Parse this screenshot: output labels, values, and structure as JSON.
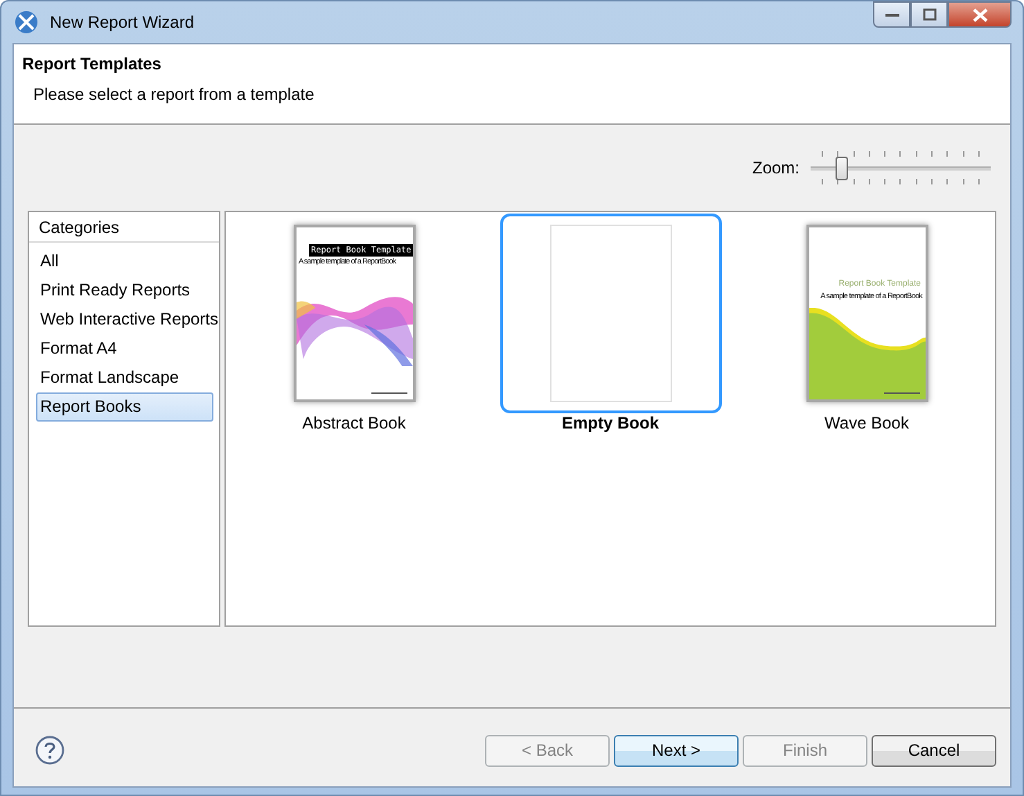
{
  "window": {
    "title": "New Report Wizard"
  },
  "header": {
    "title": "Report Templates",
    "description": "Please select a report from a template"
  },
  "zoom": {
    "label": "Zoom:",
    "level": 0.1
  },
  "categories": {
    "heading": "Categories",
    "items": [
      {
        "label": "All",
        "selected": false
      },
      {
        "label": "Print Ready Reports",
        "selected": false
      },
      {
        "label": "Web Interactive Reports",
        "selected": false
      },
      {
        "label": "Format A4",
        "selected": false
      },
      {
        "label": "Format Landscape",
        "selected": false
      },
      {
        "label": "Report Books",
        "selected": true
      }
    ]
  },
  "templates": [
    {
      "name": "Abstract Book",
      "kind": "abstract",
      "cover_title": "Report Book Template",
      "cover_subtitle": "A sample template of a ReportBook",
      "selected": false
    },
    {
      "name": "Empty Book",
      "kind": "empty",
      "selected": true
    },
    {
      "name": "Wave Book",
      "kind": "wave",
      "cover_title": "Report Book Template",
      "cover_subtitle": "A sample template of a ReportBook",
      "selected": false
    }
  ],
  "buttons": [
    {
      "label": "< Back",
      "disabled": true,
      "default": false
    },
    {
      "label": "Next >",
      "disabled": false,
      "default": true
    },
    {
      "label": "Finish",
      "disabled": true,
      "default": false
    },
    {
      "label": "Cancel",
      "disabled": false,
      "default": false
    }
  ]
}
